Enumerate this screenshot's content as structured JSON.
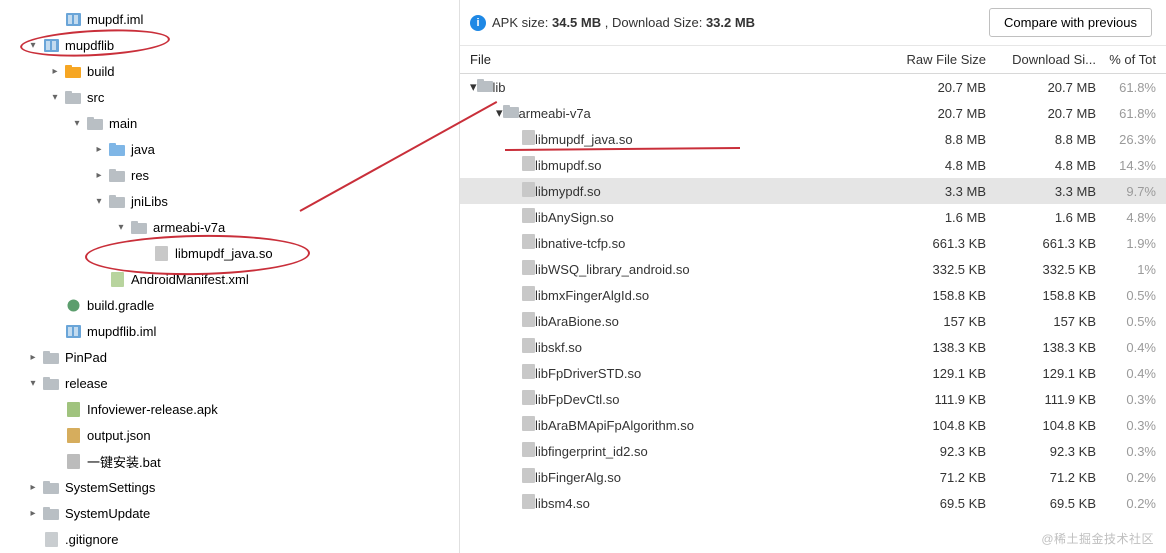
{
  "leftTree": [
    {
      "indent": 2,
      "exp": "",
      "iconCls": "module",
      "iconType": "module",
      "label": "mupdf.iml"
    },
    {
      "indent": 1,
      "exp": "▾",
      "iconCls": "module",
      "iconType": "module",
      "label": "mupdflib"
    },
    {
      "indent": 2,
      "exp": "▸",
      "iconCls": "folder-orange",
      "iconType": "folder",
      "label": "build"
    },
    {
      "indent": 2,
      "exp": "▾",
      "iconCls": "folder-dull",
      "iconType": "folder",
      "label": "src"
    },
    {
      "indent": 3,
      "exp": "▾",
      "iconCls": "folder-dull",
      "iconType": "folder",
      "label": "main"
    },
    {
      "indent": 4,
      "exp": "▸",
      "iconCls": "folder-blue",
      "iconType": "folder",
      "label": "java"
    },
    {
      "indent": 4,
      "exp": "▸",
      "iconCls": "folder-dull",
      "iconType": "folder",
      "label": "res"
    },
    {
      "indent": 4,
      "exp": "▾",
      "iconCls": "folder-dull",
      "iconType": "folder",
      "label": "jniLibs"
    },
    {
      "indent": 5,
      "exp": "▾",
      "iconCls": "folder-dull",
      "iconType": "folder",
      "label": "armeabi-v7a"
    },
    {
      "indent": 6,
      "exp": "",
      "iconCls": "file-so",
      "iconType": "file",
      "label": "libmupdf_java.so"
    },
    {
      "indent": 4,
      "exp": "",
      "iconCls": "file-xml",
      "iconType": "file",
      "label": "AndroidManifest.xml"
    },
    {
      "indent": 2,
      "exp": "",
      "iconCls": "file-gradle",
      "iconType": "gradle",
      "label": "build.gradle"
    },
    {
      "indent": 2,
      "exp": "",
      "iconCls": "module",
      "iconType": "module",
      "label": "mupdflib.iml"
    },
    {
      "indent": 1,
      "exp": "▸",
      "iconCls": "folder-dull",
      "iconType": "folder",
      "label": "PinPad"
    },
    {
      "indent": 1,
      "exp": "▾",
      "iconCls": "folder-dull",
      "iconType": "folder",
      "label": "release"
    },
    {
      "indent": 2,
      "exp": "",
      "iconCls": "file-apkish",
      "iconType": "file",
      "label": "Infoviewer-release.apk"
    },
    {
      "indent": 2,
      "exp": "",
      "iconCls": "file-json",
      "iconType": "file",
      "label": "output.json"
    },
    {
      "indent": 2,
      "exp": "",
      "iconCls": "file-bat",
      "iconType": "file",
      "label": "一键安装.bat"
    },
    {
      "indent": 1,
      "exp": "▸",
      "iconCls": "folder-dull",
      "iconType": "folder",
      "label": "SystemSettings"
    },
    {
      "indent": 1,
      "exp": "▸",
      "iconCls": "folder-dull",
      "iconType": "folder",
      "label": "SystemUpdate"
    },
    {
      "indent": 1,
      "exp": "",
      "iconCls": "file-generic",
      "iconType": "file",
      "label": ".gitignore"
    }
  ],
  "apkInfo": {
    "apkSizeLabel": "APK size:",
    "apkSizeValue": "34.5 MB",
    "downloadSizeLabel": ", Download Size:",
    "downloadSizeValue": "33.2 MB"
  },
  "compareButton": "Compare with previous",
  "tableHeaders": {
    "file": "File",
    "raw": "Raw File Size",
    "dl": "Download Si...",
    "pct": "% of Tot"
  },
  "tableRows": [
    {
      "indent": 0,
      "exp": "▾",
      "iconCls": "folder-dull",
      "iconType": "folder",
      "label": "lib",
      "raw": "20.7 MB",
      "dl": "20.7 MB",
      "pct": "61.8%"
    },
    {
      "indent": 1,
      "exp": "▾",
      "iconCls": "folder-dull",
      "iconType": "folder",
      "label": "armeabi-v7a",
      "raw": "20.7 MB",
      "dl": "20.7 MB",
      "pct": "61.8%"
    },
    {
      "indent": 2,
      "exp": "",
      "iconCls": "file-so",
      "iconType": "file",
      "label": "libmupdf_java.so",
      "raw": "8.8 MB",
      "dl": "8.8 MB",
      "pct": "26.3%"
    },
    {
      "indent": 2,
      "exp": "",
      "iconCls": "file-so",
      "iconType": "file",
      "label": "libmupdf.so",
      "raw": "4.8 MB",
      "dl": "4.8 MB",
      "pct": "14.3%"
    },
    {
      "indent": 2,
      "exp": "",
      "iconCls": "file-so",
      "iconType": "file",
      "label": "libmypdf.so",
      "raw": "3.3 MB",
      "dl": "3.3 MB",
      "pct": "9.7%",
      "selected": true
    },
    {
      "indent": 2,
      "exp": "",
      "iconCls": "file-so",
      "iconType": "file",
      "label": "libAnySign.so",
      "raw": "1.6 MB",
      "dl": "1.6 MB",
      "pct": "4.8%"
    },
    {
      "indent": 2,
      "exp": "",
      "iconCls": "file-so",
      "iconType": "file",
      "label": "libnative-tcfp.so",
      "raw": "661.3 KB",
      "dl": "661.3 KB",
      "pct": "1.9%"
    },
    {
      "indent": 2,
      "exp": "",
      "iconCls": "file-so",
      "iconType": "file",
      "label": "libWSQ_library_android.so",
      "raw": "332.5 KB",
      "dl": "332.5 KB",
      "pct": "1%"
    },
    {
      "indent": 2,
      "exp": "",
      "iconCls": "file-so",
      "iconType": "file",
      "label": "libmxFingerAlgId.so",
      "raw": "158.8 KB",
      "dl": "158.8 KB",
      "pct": "0.5%"
    },
    {
      "indent": 2,
      "exp": "",
      "iconCls": "file-so",
      "iconType": "file",
      "label": "libAraBione.so",
      "raw": "157 KB",
      "dl": "157 KB",
      "pct": "0.5%"
    },
    {
      "indent": 2,
      "exp": "",
      "iconCls": "file-so",
      "iconType": "file",
      "label": "libskf.so",
      "raw": "138.3 KB",
      "dl": "138.3 KB",
      "pct": "0.4%"
    },
    {
      "indent": 2,
      "exp": "",
      "iconCls": "file-so",
      "iconType": "file",
      "label": "libFpDriverSTD.so",
      "raw": "129.1 KB",
      "dl": "129.1 KB",
      "pct": "0.4%"
    },
    {
      "indent": 2,
      "exp": "",
      "iconCls": "file-so",
      "iconType": "file",
      "label": "libFpDevCtl.so",
      "raw": "111.9 KB",
      "dl": "111.9 KB",
      "pct": "0.3%"
    },
    {
      "indent": 2,
      "exp": "",
      "iconCls": "file-so",
      "iconType": "file",
      "label": "libAraBMApiFpAlgorithm.so",
      "raw": "104.8 KB",
      "dl": "104.8 KB",
      "pct": "0.3%"
    },
    {
      "indent": 2,
      "exp": "",
      "iconCls": "file-so",
      "iconType": "file",
      "label": "libfingerprint_id2.so",
      "raw": "92.3 KB",
      "dl": "92.3 KB",
      "pct": "0.3%"
    },
    {
      "indent": 2,
      "exp": "",
      "iconCls": "file-so",
      "iconType": "file",
      "label": "libFingerAlg.so",
      "raw": "71.2 KB",
      "dl": "71.2 KB",
      "pct": "0.2%"
    },
    {
      "indent": 2,
      "exp": "",
      "iconCls": "file-so",
      "iconType": "file",
      "label": "libsm4.so",
      "raw": "69.5 KB",
      "dl": "69.5 KB",
      "pct": "0.2%"
    }
  ],
  "watermark": "@稀土掘金技术社区"
}
